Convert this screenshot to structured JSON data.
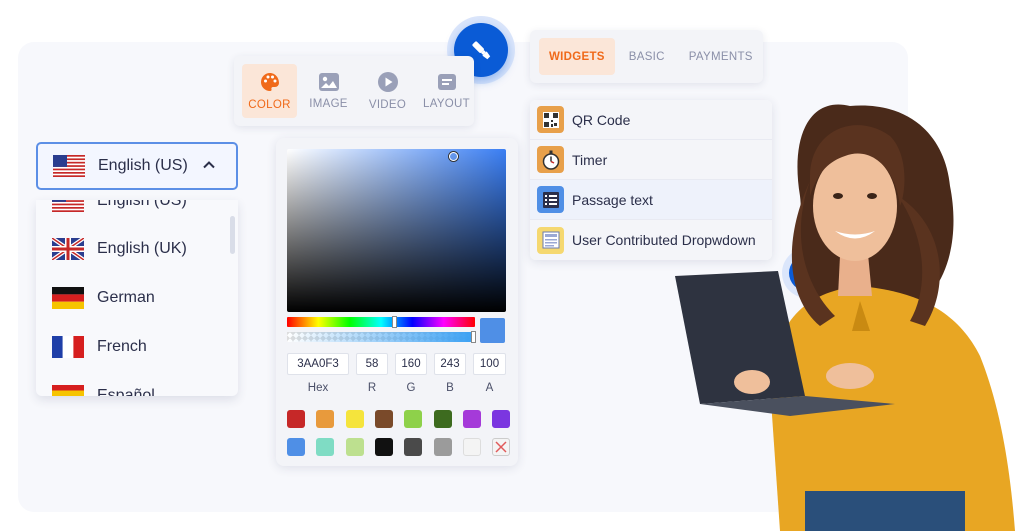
{
  "media_tabs": [
    {
      "label": "COLOR",
      "icon": "palette-icon",
      "active": true
    },
    {
      "label": "IMAGE",
      "icon": "image-icon",
      "active": false
    },
    {
      "label": "VIDEO",
      "icon": "play-icon",
      "active": false
    },
    {
      "label": "LAYOUT",
      "icon": "layout-icon",
      "active": false
    }
  ],
  "widget_tabs": [
    {
      "label": "WIDGETS",
      "active": true
    },
    {
      "label": "BASIC",
      "active": false
    },
    {
      "label": "PAYMENTS",
      "active": false
    }
  ],
  "widgets": [
    {
      "label": "QR Code",
      "icon": "qr-code-icon"
    },
    {
      "label": "Timer",
      "icon": "stopwatch-icon"
    },
    {
      "label": "Passage text",
      "icon": "passage-text-icon"
    },
    {
      "label": "User Contributed Dropwdown",
      "icon": "dropdown-list-icon"
    }
  ],
  "language": {
    "selected": "English (US)",
    "options": [
      "English (US)",
      "English (UK)",
      "German",
      "French",
      "Español"
    ]
  },
  "color_picker": {
    "hex": "3AA0F3",
    "r": "58",
    "g": "160",
    "b": "243",
    "a": "100",
    "labels": {
      "hex": "Hex",
      "r": "R",
      "g": "G",
      "b": "B",
      "a": "A"
    },
    "hue_fraction": 0.58,
    "alpha_fraction": 1.0,
    "preset_colors": [
      "#c62828",
      "#e89a3c",
      "#f5e43c",
      "#7a4a2a",
      "#8ed14a",
      "#3d6b1f",
      "#a53ad9",
      "#7b36e0",
      "#4f8fe6",
      "#7fdcc4",
      "#bde08f",
      "#111111",
      "#4a4a4a",
      "#9b9b9b",
      "#f4f4f4",
      "none"
    ]
  },
  "colors": {
    "accent": "#f06a1a",
    "accent_bg": "#fbe6d8",
    "primary": "#0a5bd6"
  }
}
